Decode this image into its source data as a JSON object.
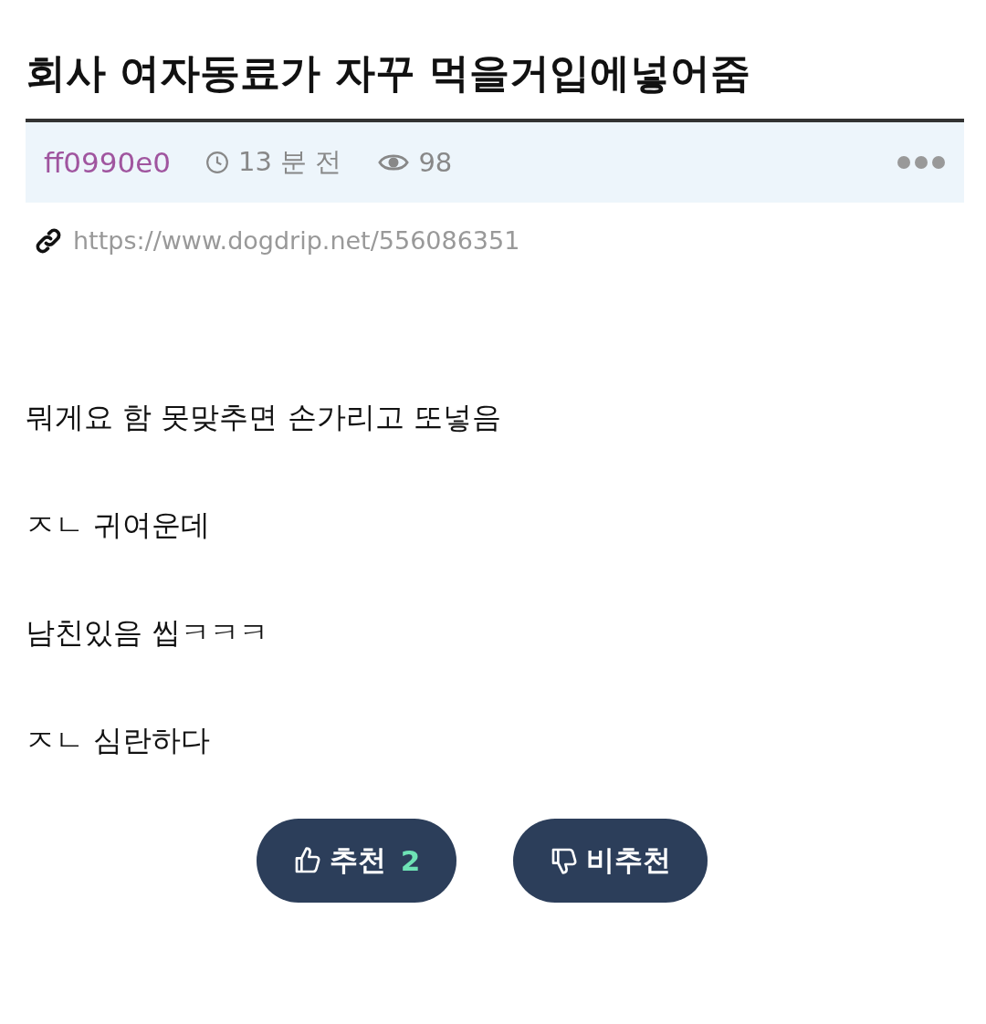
{
  "post": {
    "title": "회사 여자동료가 자꾸 먹을거입에넣어줌",
    "author": "ff0990e0",
    "time": "13 분 전",
    "views": "98",
    "url": "https://www.dogdrip.net/556086351"
  },
  "paragraphs": [
    "뭐게요 함 못맞추면 손가리고 또넣음",
    "ㅈㄴ 귀여운데",
    "남친있음 씹ㅋㅋㅋ",
    "ㅈㄴ 심란하다"
  ],
  "buttons": [
    {
      "kind": "upvote",
      "label": "추천",
      "count": "2"
    },
    {
      "kind": "downvote",
      "label": "비추천"
    }
  ]
}
